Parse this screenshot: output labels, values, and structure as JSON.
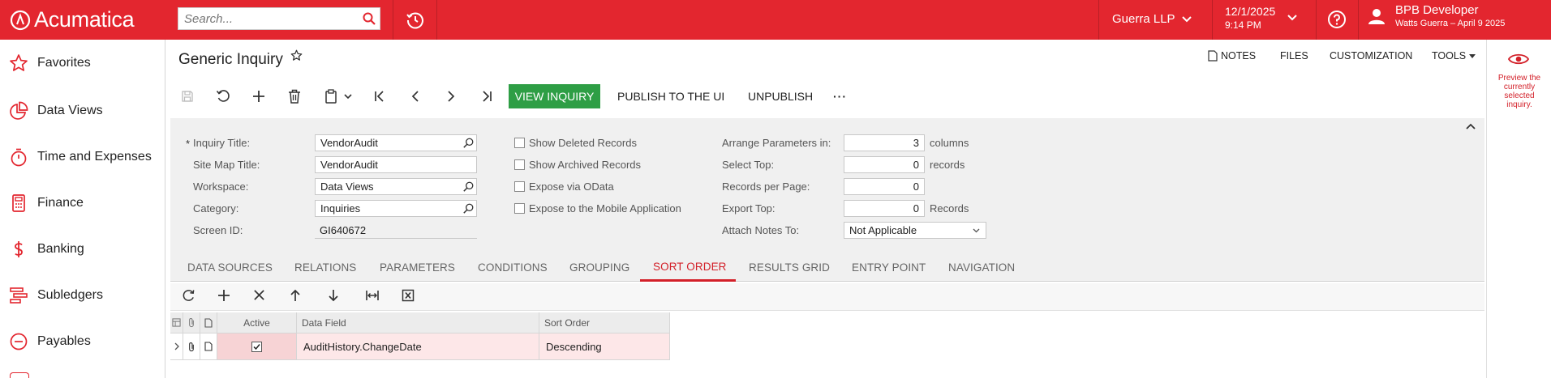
{
  "header": {
    "logo_text": "Acumatica",
    "search_placeholder": "Search...",
    "company": "Guerra LLP",
    "date": "12/1/2025",
    "time": "9:14 PM",
    "user_name": "BPB Developer",
    "user_sub": "Watts Guerra – April 9 2025",
    "accent_color": "#e3262f"
  },
  "sidebar": {
    "items": [
      {
        "label": "Favorites",
        "icon": "star-icon"
      },
      {
        "label": "Data Views",
        "icon": "pie-chart-icon"
      },
      {
        "label": "Time and Expenses",
        "icon": "stopwatch-icon"
      },
      {
        "label": "Finance",
        "icon": "calculator-icon"
      },
      {
        "label": "Banking",
        "icon": "dollar-icon"
      },
      {
        "label": "Subledgers",
        "icon": "subledgers-icon"
      },
      {
        "label": "Payables",
        "icon": "minus-circle-icon"
      }
    ]
  },
  "page": {
    "title": "Generic Inquiry",
    "links": {
      "notes": "NOTES",
      "files": "FILES",
      "customization": "CUSTOMIZATION",
      "tools": "TOOLS"
    }
  },
  "toolbar": {
    "view_inquiry": "VIEW INQUIRY",
    "publish": "PUBLISH TO THE UI",
    "unpublish": "UNPUBLISH",
    "more": "···"
  },
  "form": {
    "required_mark": "*",
    "inquiry_title_label": "Inquiry Title:",
    "inquiry_title_value": "VendorAudit",
    "site_map_title_label": "Site Map Title:",
    "site_map_title_value": "VendorAudit",
    "workspace_label": "Workspace:",
    "workspace_value": "Data Views",
    "category_label": "Category:",
    "category_value": "Inquiries",
    "screen_id_label": "Screen ID:",
    "screen_id_value": "GI640672",
    "show_deleted": "Show Deleted Records",
    "show_archived": "Show Archived Records",
    "expose_odata": "Expose via OData",
    "expose_mobile": "Expose to the Mobile Application",
    "arrange_label": "Arrange Parameters in:",
    "arrange_value": "3",
    "arrange_unit": "columns",
    "select_top_label": "Select Top:",
    "select_top_value": "0",
    "select_top_unit": "records",
    "rpp_label": "Records per Page:",
    "rpp_value": "0",
    "export_top_label": "Export Top:",
    "export_top_value": "0",
    "export_top_unit": "Records",
    "attach_label": "Attach Notes To:",
    "attach_value": "Not Applicable"
  },
  "tabs": [
    {
      "label": "DATA SOURCES"
    },
    {
      "label": "RELATIONS"
    },
    {
      "label": "PARAMETERS"
    },
    {
      "label": "CONDITIONS"
    },
    {
      "label": "GROUPING"
    },
    {
      "label": "SORT ORDER",
      "active": true
    },
    {
      "label": "RESULTS GRID"
    },
    {
      "label": "ENTRY POINT"
    },
    {
      "label": "NAVIGATION"
    }
  ],
  "grid": {
    "columns": [
      "Active",
      "Data Field",
      "Sort Order"
    ],
    "rows": [
      {
        "active": true,
        "data_field": "AuditHistory.ChangeDate",
        "sort_order": "Descending"
      }
    ]
  },
  "right_panel": {
    "tooltip": "Preview the currently selected inquiry."
  }
}
